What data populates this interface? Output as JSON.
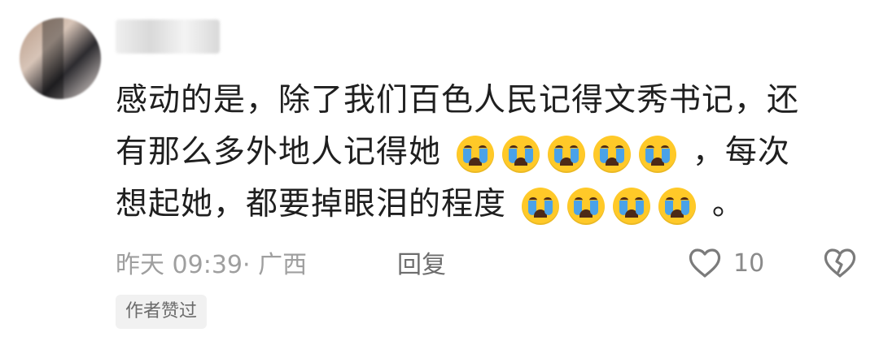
{
  "comment": {
    "username": "",
    "lines": [
      "感动的是，除了我们百色人民记得文秀书记，还",
      "有那么多外地人记得她",
      "，每次",
      "想起她，都要掉眼泪的程度",
      "。"
    ],
    "emoji_sets": {
      "line2": [
        "crying-face-icon",
        "crying-face-icon",
        "crying-face-icon",
        "crying-face-icon",
        "crying-face-icon"
      ],
      "line3": [
        "crying-face-icon",
        "crying-face-icon",
        "crying-face-icon",
        "crying-face-icon"
      ]
    },
    "meta": "昨天 09:39· 广西",
    "reply_label": "回复",
    "likes": "10",
    "badge": "作者赞过"
  },
  "colors": {
    "text": "#1f1f1f",
    "meta": "#9f9f9f",
    "badge_bg": "#f1f1f1",
    "emoji_yellow": "#ffc928",
    "tear_blue": "#4aa2e8"
  }
}
